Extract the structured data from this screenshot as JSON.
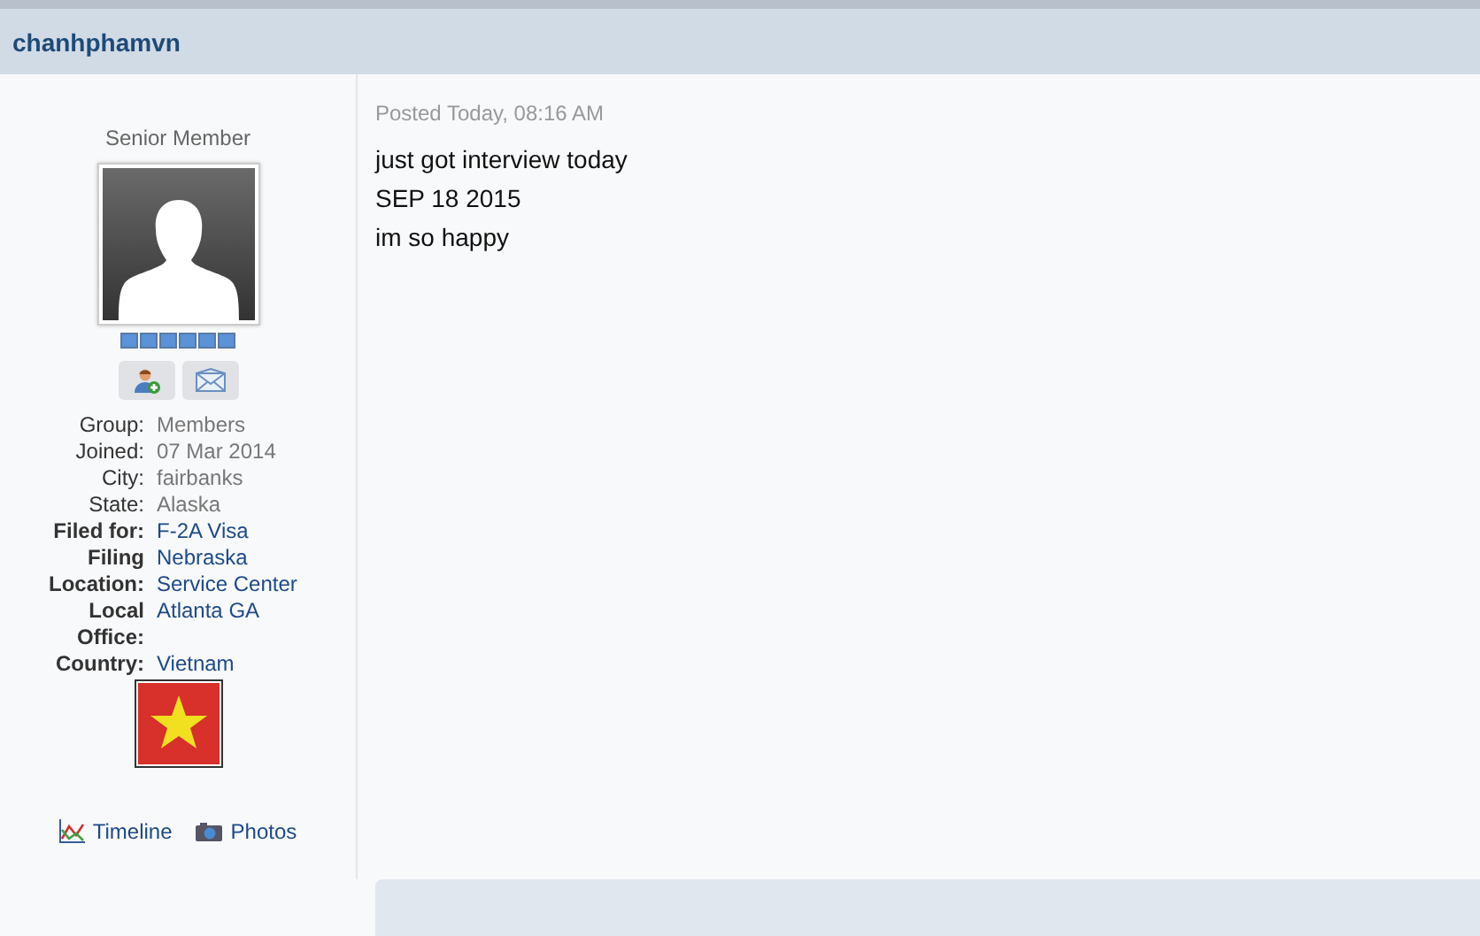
{
  "post_header": {
    "author": "chanhphamvn"
  },
  "profile": {
    "rank": "Senior Member",
    "stars": 6,
    "fields": [
      {
        "label": "Group:",
        "value": "Members",
        "kind": "standard"
      },
      {
        "label": "Joined:",
        "value": "07 Mar 2014",
        "kind": "standard"
      },
      {
        "label": "City:",
        "value": "fairbanks",
        "kind": "standard"
      },
      {
        "label": "State:",
        "value": "Alaska",
        "kind": "standard"
      },
      {
        "label": "Filed for:",
        "value": "F-2A Visa",
        "kind": "custom"
      },
      {
        "label": "Filing Location:",
        "value": "Nebraska Service Center",
        "kind": "custom"
      },
      {
        "label": "Local Office:",
        "value": "Atlanta GA",
        "kind": "custom"
      },
      {
        "label": "Country:",
        "value": "Vietnam",
        "kind": "custom"
      }
    ],
    "links": [
      {
        "label": "Timeline",
        "kind": "timeline"
      },
      {
        "label": "Photos",
        "kind": "photos"
      }
    ]
  },
  "post": {
    "posted": "Posted Today, 08:16 AM",
    "lines": [
      "just got interview today",
      "SEP 18 2015",
      "im so happy"
    ]
  }
}
